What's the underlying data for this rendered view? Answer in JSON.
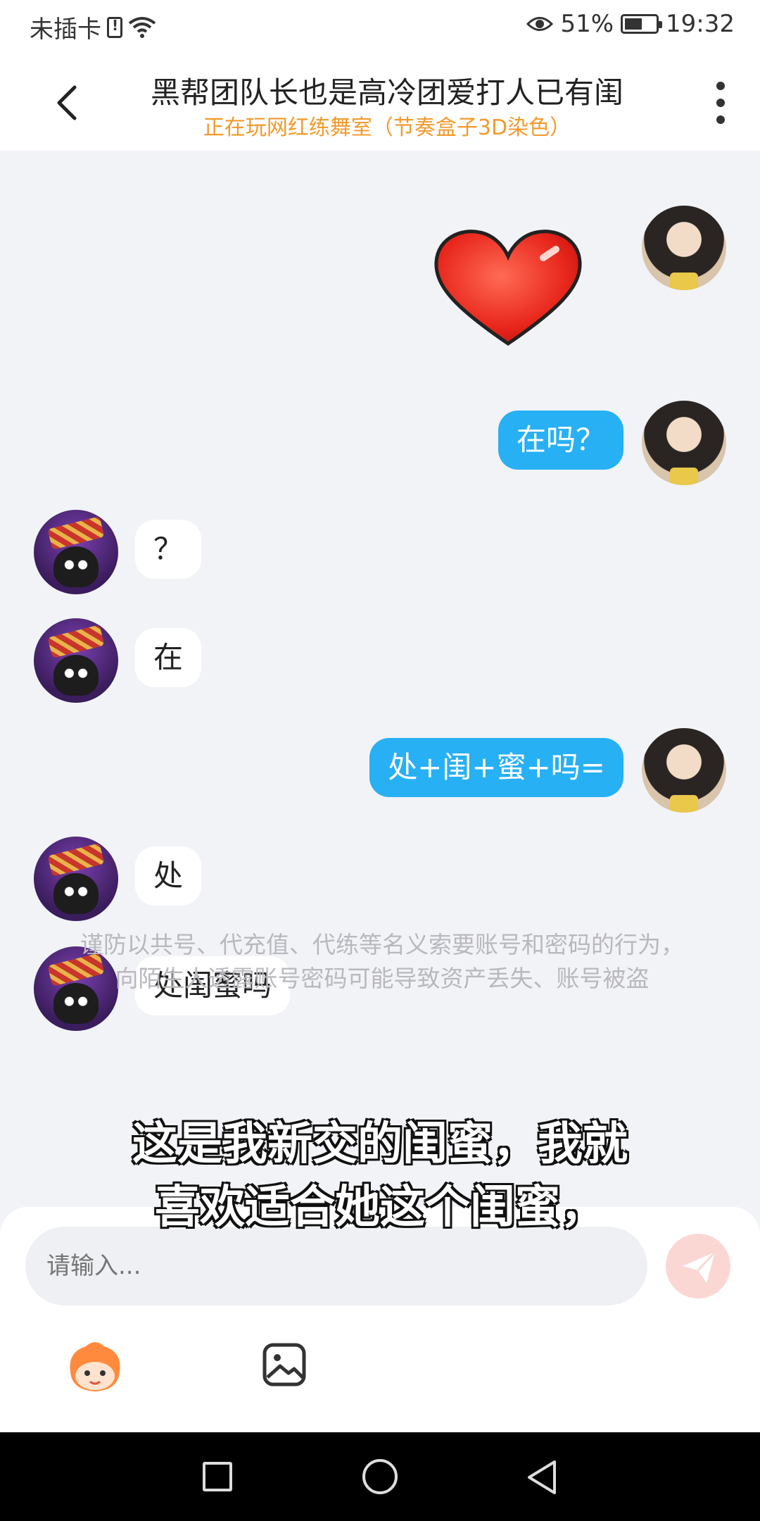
{
  "status_bar": {
    "carrier": "未插卡",
    "battery_percent": "51%",
    "time": "19:32"
  },
  "header": {
    "title": "黑帮团队长也是高冷团爱打人已有闺",
    "subtitle": "正在玩网红练舞室（节奏盒子3D染色）"
  },
  "messages": [
    {
      "side": "me",
      "type": "sticker",
      "sticker": "heart-sticker"
    },
    {
      "side": "me",
      "type": "text",
      "text": "在吗？"
    },
    {
      "side": "other",
      "type": "text",
      "text": "？"
    },
    {
      "side": "other",
      "type": "text",
      "text": "在"
    },
    {
      "side": "me",
      "type": "text",
      "text": "处+闺+蜜+吗="
    },
    {
      "side": "other",
      "type": "text",
      "text": "处"
    },
    {
      "side": "other",
      "type": "text",
      "text": "处闺蜜吗"
    }
  ],
  "notice": "谨防以共号、代充值、代练等名义索要账号和密码的行为，向陌生人透露账号密码可能导致资产丢失、账号被盗",
  "caption": "这是我新交的闺蜜，我就喜欢适合她这个闺蜜，",
  "input": {
    "placeholder": "请输入..."
  },
  "colors": {
    "my_bubble": "#28b0f4",
    "subtitle_accent": "#f19a2c",
    "send_button": "#fbd7d4"
  }
}
